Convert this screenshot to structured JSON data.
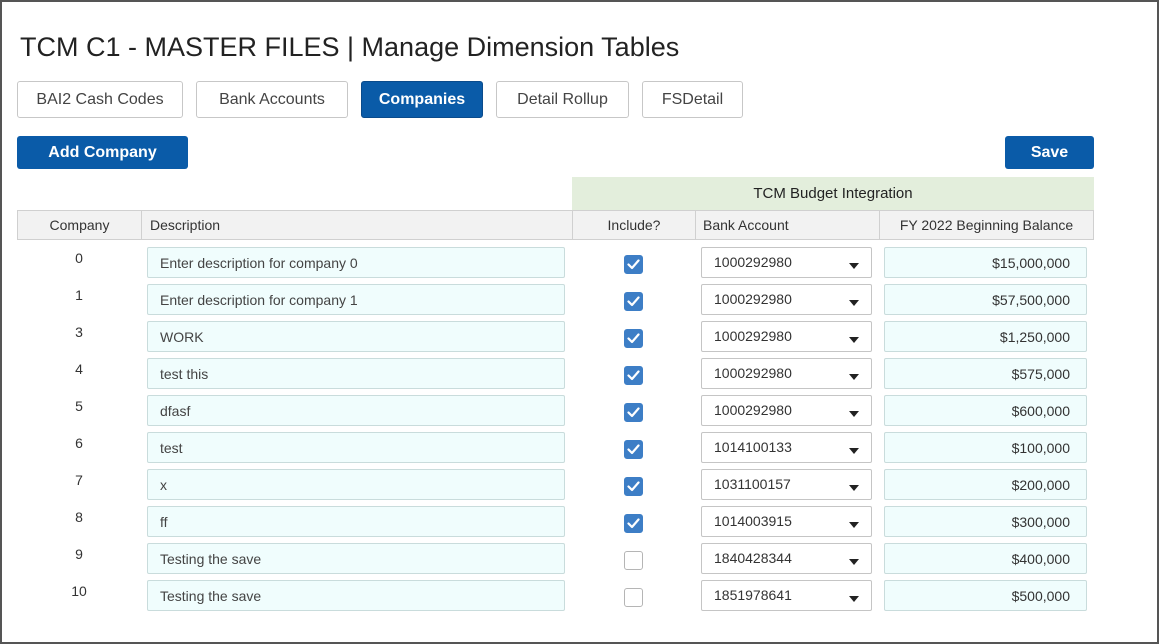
{
  "title": "TCM C1 - MASTER FILES | Manage Dimension Tables",
  "tabs": [
    {
      "label": "BAI2 Cash Codes",
      "active": false
    },
    {
      "label": "Bank Accounts",
      "active": false
    },
    {
      "label": "Companies",
      "active": true
    },
    {
      "label": "Detail Rollup",
      "active": false
    },
    {
      "label": "FSDetail",
      "active": false
    }
  ],
  "actions": {
    "add_label": "Add Company",
    "save_label": "Save"
  },
  "group_header": "TCM Budget Integration",
  "columns": {
    "company": "Company",
    "description": "Description",
    "include": "Include?",
    "bank_account": "Bank Account",
    "balance": "FY 2022 Beginning Balance"
  },
  "rows": [
    {
      "company": "0",
      "description": "Enter description for company 0",
      "include": true,
      "bank_account": "1000292980",
      "balance": "$15,000,000"
    },
    {
      "company": "1",
      "description": "Enter description for company 1",
      "include": true,
      "bank_account": "1000292980",
      "balance": "$57,500,000"
    },
    {
      "company": "3",
      "description": "WORK",
      "include": true,
      "bank_account": "1000292980",
      "balance": "$1,250,000"
    },
    {
      "company": "4",
      "description": "test this",
      "include": true,
      "bank_account": "1000292980",
      "balance": "$575,000"
    },
    {
      "company": "5",
      "description": "dfasf",
      "include": true,
      "bank_account": "1000292980",
      "balance": "$600,000"
    },
    {
      "company": "6",
      "description": "test",
      "include": true,
      "bank_account": "1014100133",
      "balance": "$100,000"
    },
    {
      "company": "7",
      "description": "x",
      "include": true,
      "bank_account": "1031100157",
      "balance": "$200,000"
    },
    {
      "company": "8",
      "description": "ff",
      "include": true,
      "bank_account": "1014003915",
      "balance": "$300,000"
    },
    {
      "company": "9",
      "description": "Testing the save",
      "include": false,
      "bank_account": "1840428344",
      "balance": "$400,000"
    },
    {
      "company": "10",
      "description": "Testing the save",
      "include": false,
      "bank_account": "1851978641",
      "balance": "$500,000"
    }
  ],
  "icons": {
    "checkbox_checked": "check-icon",
    "select_arrow": "caret-down-icon"
  },
  "colors": {
    "primary": "#0a5ba8",
    "group_header_bg": "#e3eedc",
    "input_bg": "#f0fdfd",
    "checkbox": "#3d7ec6"
  }
}
